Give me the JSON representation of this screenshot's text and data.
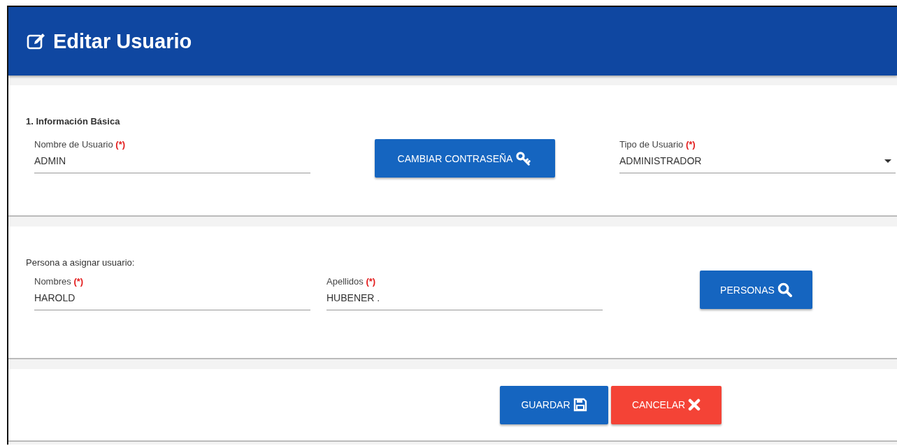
{
  "header": {
    "title": "Editar Usuario"
  },
  "basic_info": {
    "title": "1. Información Básica",
    "username": {
      "label": "Nombre de Usuario",
      "required_mark": "(*)",
      "value": "ADMIN"
    },
    "change_password_button": {
      "label": "CAMBIAR CONTRASEÑA"
    },
    "user_type": {
      "label": "Tipo de Usuario",
      "required_mark": "(*)",
      "value": "ADMINISTRADOR"
    }
  },
  "person": {
    "title": "Persona a asignar usuario:",
    "fields": [
      {
        "label": "Nombres",
        "required_mark": "(*)",
        "value": "HAROLD"
      },
      {
        "label": "Apellidos",
        "required_mark": "(*)",
        "value": "HUBENER ."
      }
    ],
    "search_button": {
      "label": "PERSONAS"
    }
  },
  "actions": [
    {
      "label": "GUARDAR",
      "kind": "save"
    },
    {
      "label": "CANCELAR",
      "kind": "cancel"
    }
  ]
}
